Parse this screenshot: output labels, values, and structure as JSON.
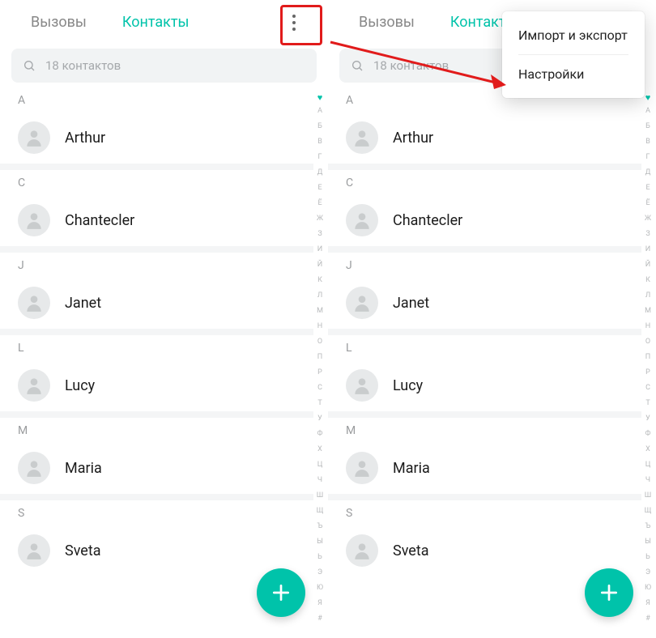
{
  "colors": {
    "accent": "#00c3aa",
    "annotation": "#e11b1b"
  },
  "tabs": {
    "calls": "Вызовы",
    "contacts": "Контакты"
  },
  "search": {
    "placeholder": "18 контактов"
  },
  "sections": [
    {
      "letter": "A",
      "contacts": [
        "Arthur"
      ]
    },
    {
      "letter": "C",
      "contacts": [
        "Chantecler"
      ]
    },
    {
      "letter": "J",
      "contacts": [
        "Janet"
      ]
    },
    {
      "letter": "L",
      "contacts": [
        "Lucy"
      ]
    },
    {
      "letter": "M",
      "contacts": [
        "Maria"
      ]
    },
    {
      "letter": "S",
      "contacts": [
        "Sveta"
      ]
    }
  ],
  "index_letters": [
    "А",
    "Б",
    "В",
    "Г",
    "Д",
    "Е",
    "Ё",
    "Ж",
    "З",
    "И",
    "Й",
    "К",
    "Л",
    "М",
    "Н",
    "О",
    "П",
    "Р",
    "С",
    "Т",
    "У",
    "Ф",
    "Х",
    "Ц",
    "Ч",
    "Ш",
    "Щ",
    "Ъ",
    "Ы",
    "Ь",
    "Э",
    "Ю",
    "Я",
    "#"
  ],
  "overflow": {
    "import_export": "Импорт и экспорт",
    "settings": "Настройки"
  },
  "icons": {
    "more": "more-vertical-icon",
    "search": "search-icon",
    "avatar": "person-icon",
    "fab": "plus-icon",
    "heart": "heart-icon"
  }
}
